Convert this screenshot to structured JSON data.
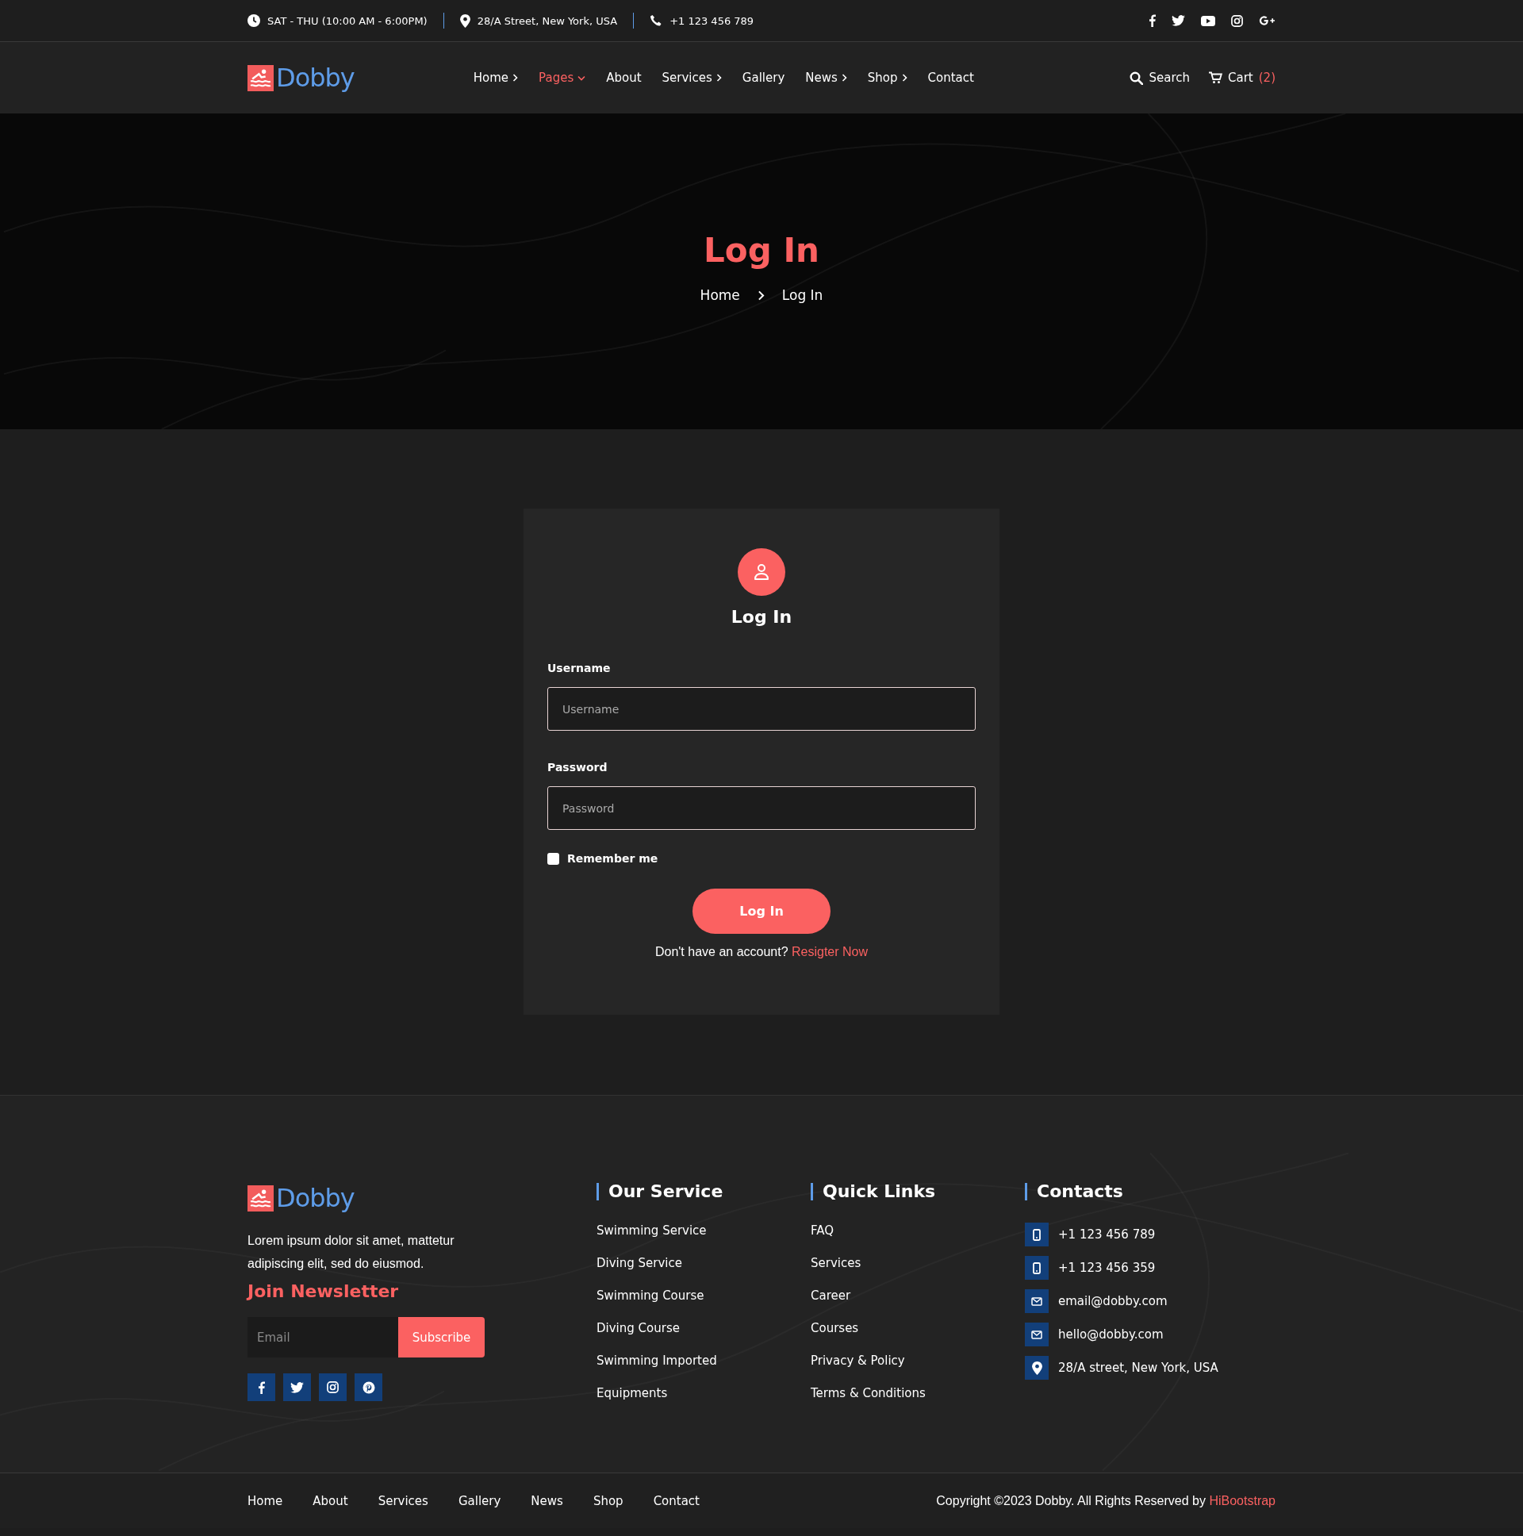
{
  "top_bar": {
    "hours": "SAT - THU (10:00 AM - 6:00PM)",
    "address": "28/A Street, New York, USA",
    "phone": "+1 123 456 789"
  },
  "header": {
    "logo": "Dobby",
    "nav": [
      {
        "label": "Home",
        "has_submenu": true,
        "expanded": false,
        "selected": false
      },
      {
        "label": "Pages",
        "has_submenu": true,
        "expanded": true,
        "selected": true
      },
      {
        "label": "About",
        "has_submenu": false,
        "expanded": false,
        "selected": false
      },
      {
        "label": "Services",
        "has_submenu": true,
        "expanded": false,
        "selected": false
      },
      {
        "label": "Gallery",
        "has_submenu": false,
        "expanded": false,
        "selected": false
      },
      {
        "label": "News",
        "has_submenu": true,
        "expanded": false,
        "selected": false
      },
      {
        "label": "Shop",
        "has_submenu": true,
        "expanded": false,
        "selected": false
      },
      {
        "label": "Contact",
        "has_submenu": false,
        "expanded": false,
        "selected": false
      }
    ],
    "search": "Search",
    "cart": {
      "label": "Cart",
      "count": "(2)"
    }
  },
  "hero": {
    "title": "Log In",
    "breadcrumb": [
      "Home",
      "Log In"
    ]
  },
  "login": {
    "title": "Log In",
    "fields": [
      {
        "label": "Username",
        "placeholder": "Username"
      },
      {
        "label": "Password",
        "placeholder": "Password"
      }
    ],
    "remember": {
      "label": "Remember me",
      "checked": false
    },
    "button": "Log In",
    "signup_prompt": "Don't have an account?",
    "signup_link": "Resigter Now"
  },
  "footer": {
    "logo": "Dobby",
    "about": "Lorem ipsum dolor sit amet, mattetur adipiscing elit, sed do eiusmod.",
    "newsletter": {
      "title": "Join Newsletter",
      "placeholder": "Email",
      "button": "Subscribe"
    },
    "columns": [
      {
        "title": "Our Service",
        "links": [
          "Swimming Service",
          "Diving Service",
          "Swimming Course",
          "Diving Course",
          "Swimming Imported",
          "Equipments"
        ]
      },
      {
        "title": "Quick Links",
        "links": [
          "FAQ",
          "Services",
          "Career",
          "Courses",
          "Privacy & Policy",
          "Terms & Conditions"
        ]
      }
    ],
    "contacts": {
      "title": "Contacts",
      "items": [
        {
          "kind": "phone",
          "text": "+1 123 456 789"
        },
        {
          "kind": "phone",
          "text": "+1 123 456 359"
        },
        {
          "kind": "email",
          "text": "email@dobby.com"
        },
        {
          "kind": "email",
          "text": "hello@dobby.com"
        },
        {
          "kind": "location",
          "text": "28/A street, New York, USA"
        }
      ]
    },
    "bottom_links": [
      "Home",
      "About",
      "Services",
      "Gallery",
      "News",
      "Shop",
      "Contact"
    ],
    "copyright": "Copyright ©2023 Dobby. All Rights Reserved by",
    "copyright_link": "HiBootstrap"
  }
}
